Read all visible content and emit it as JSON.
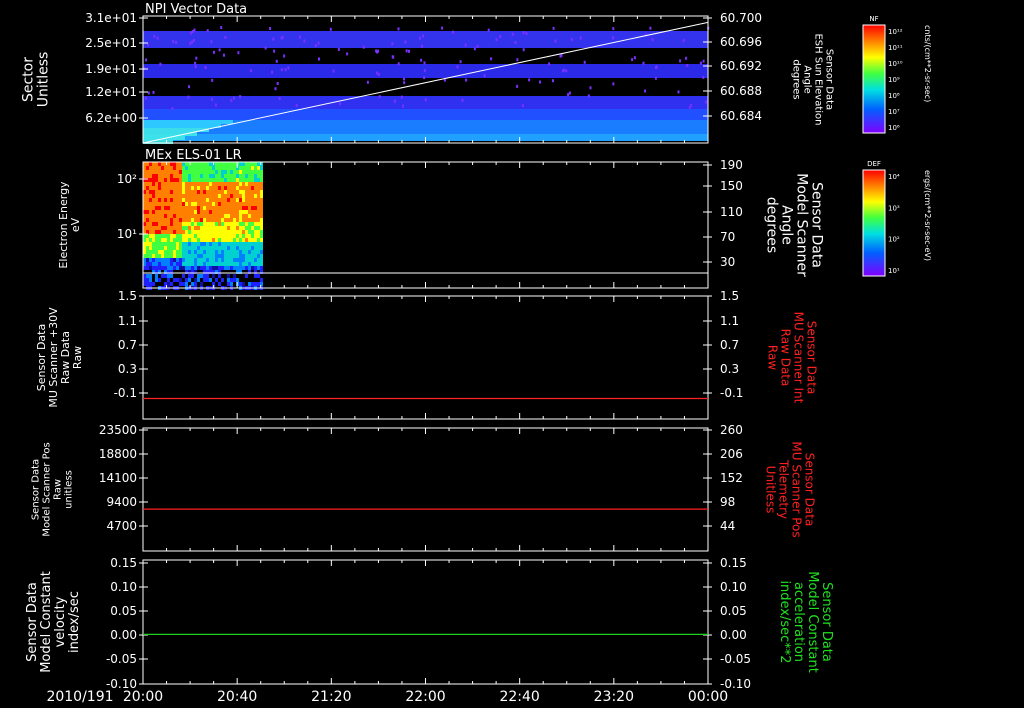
{
  "date_label": "2010/191",
  "x_ticks": [
    "20:00",
    "20:40",
    "21:20",
    "22:00",
    "22:40",
    "23:20",
    "00:00"
  ],
  "colors": {
    "background": "#000000",
    "axis": "#ffffff",
    "red_trace": "#ff2020",
    "green_trace": "#20d020",
    "label_red": "#ff2020",
    "label_green": "#20e020"
  },
  "chart_data": [
    {
      "type": "heatmap",
      "title": "NPI Vector Data",
      "ylabel": [
        "Sector",
        "Unitless"
      ],
      "yticks": [
        "3.1e+01",
        "2.5e+01",
        "1.9e+01",
        "1.2e+01",
        "6.2e+00"
      ],
      "right_ylabel": [
        "Sensor Data",
        "ESH Sun Elevation",
        "Angle",
        "degrees"
      ],
      "right_yticks": [
        "60.700",
        "60.696",
        "60.692",
        "60.688",
        "60.684"
      ],
      "right_ylim": [
        60.68,
        60.7
      ],
      "overlay_line": {
        "x": [
          "20:00",
          "00:00"
        ],
        "y": [
          60.68,
          60.699
        ]
      },
      "colorbar": {
        "label": "NF",
        "units": "cnts/(cm**2-sr-sec)",
        "ticks": [
          "10¹²",
          "10¹¹",
          "10¹⁰",
          "10⁹",
          "10⁸",
          "10⁷",
          "10⁶"
        ]
      }
    },
    {
      "type": "heatmap",
      "title": "MEx ELS-01 LR",
      "ylabel": [
        "Electron Energy",
        "eV"
      ],
      "yticks": [
        "10²",
        "10¹"
      ],
      "right_ylabel": [
        "Sensor Data",
        "Model Scanner",
        "Angle",
        "degrees"
      ],
      "right_yticks": [
        "190",
        "150",
        "110",
        "70",
        "30"
      ],
      "right_ylim": [
        0,
        190
      ],
      "data_end_time": "20:50",
      "colorbar": {
        "label": "DEF",
        "units": "ergs/(cm**2-sr-sec-eV)",
        "ticks": [
          "10⁴",
          "10³",
          "10²",
          "10¹"
        ]
      }
    },
    {
      "type": "line",
      "ylabel": [
        "Sensor Data",
        "MU Scanner +30V",
        "Raw Data",
        "Raw"
      ],
      "yticks": [
        "1.5",
        "1.1",
        "0.7",
        "0.3",
        "-0.1"
      ],
      "ylim": [
        -0.3,
        1.5
      ],
      "right_ylabel": [
        "Sensor Data",
        "MU Scanner Int",
        "Raw Data",
        "Raw"
      ],
      "right_yticks": [
        "1.5",
        "1.1",
        "0.7",
        "0.3",
        "-0.1"
      ],
      "series": [
        {
          "x": [
            "20:00",
            "00:00"
          ],
          "y": [
            0.0,
            0.0
          ]
        }
      ]
    },
    {
      "type": "line",
      "ylabel": [
        "Sensor Data",
        "Model Scanner Pos",
        "Raw",
        "unitless"
      ],
      "yticks": [
        "23500",
        "18800",
        "14100",
        "9400",
        "4700"
      ],
      "ylim": [
        0,
        23500
      ],
      "right_ylabel": [
        "Sensor Data",
        "MU Scanner Pos",
        "Telemetry",
        "Unitless"
      ],
      "right_yticks": [
        "260",
        "206",
        "152",
        "98",
        "44"
      ],
      "series": [
        {
          "x": [
            "20:00",
            "00:00"
          ],
          "y": [
            8000,
            8000
          ]
        }
      ]
    },
    {
      "type": "line",
      "ylabel": [
        "Sensor Data",
        "Model Constant",
        "velocity",
        "index/sec"
      ],
      "yticks": [
        "0.15",
        "0.10",
        "0.05",
        "0.00",
        "-0.05",
        "-0.10"
      ],
      "ylim": [
        -0.1,
        0.15
      ],
      "right_ylabel": [
        "Sensor Data",
        "Model Constant",
        "acceleration",
        "index/sec**2"
      ],
      "right_yticks": [
        "0.15",
        "0.10",
        "0.05",
        "0.00",
        "-0.05",
        "-0.10"
      ],
      "series": [
        {
          "x": [
            "20:00",
            "00:00"
          ],
          "y": [
            0.0,
            0.0
          ]
        }
      ]
    }
  ]
}
